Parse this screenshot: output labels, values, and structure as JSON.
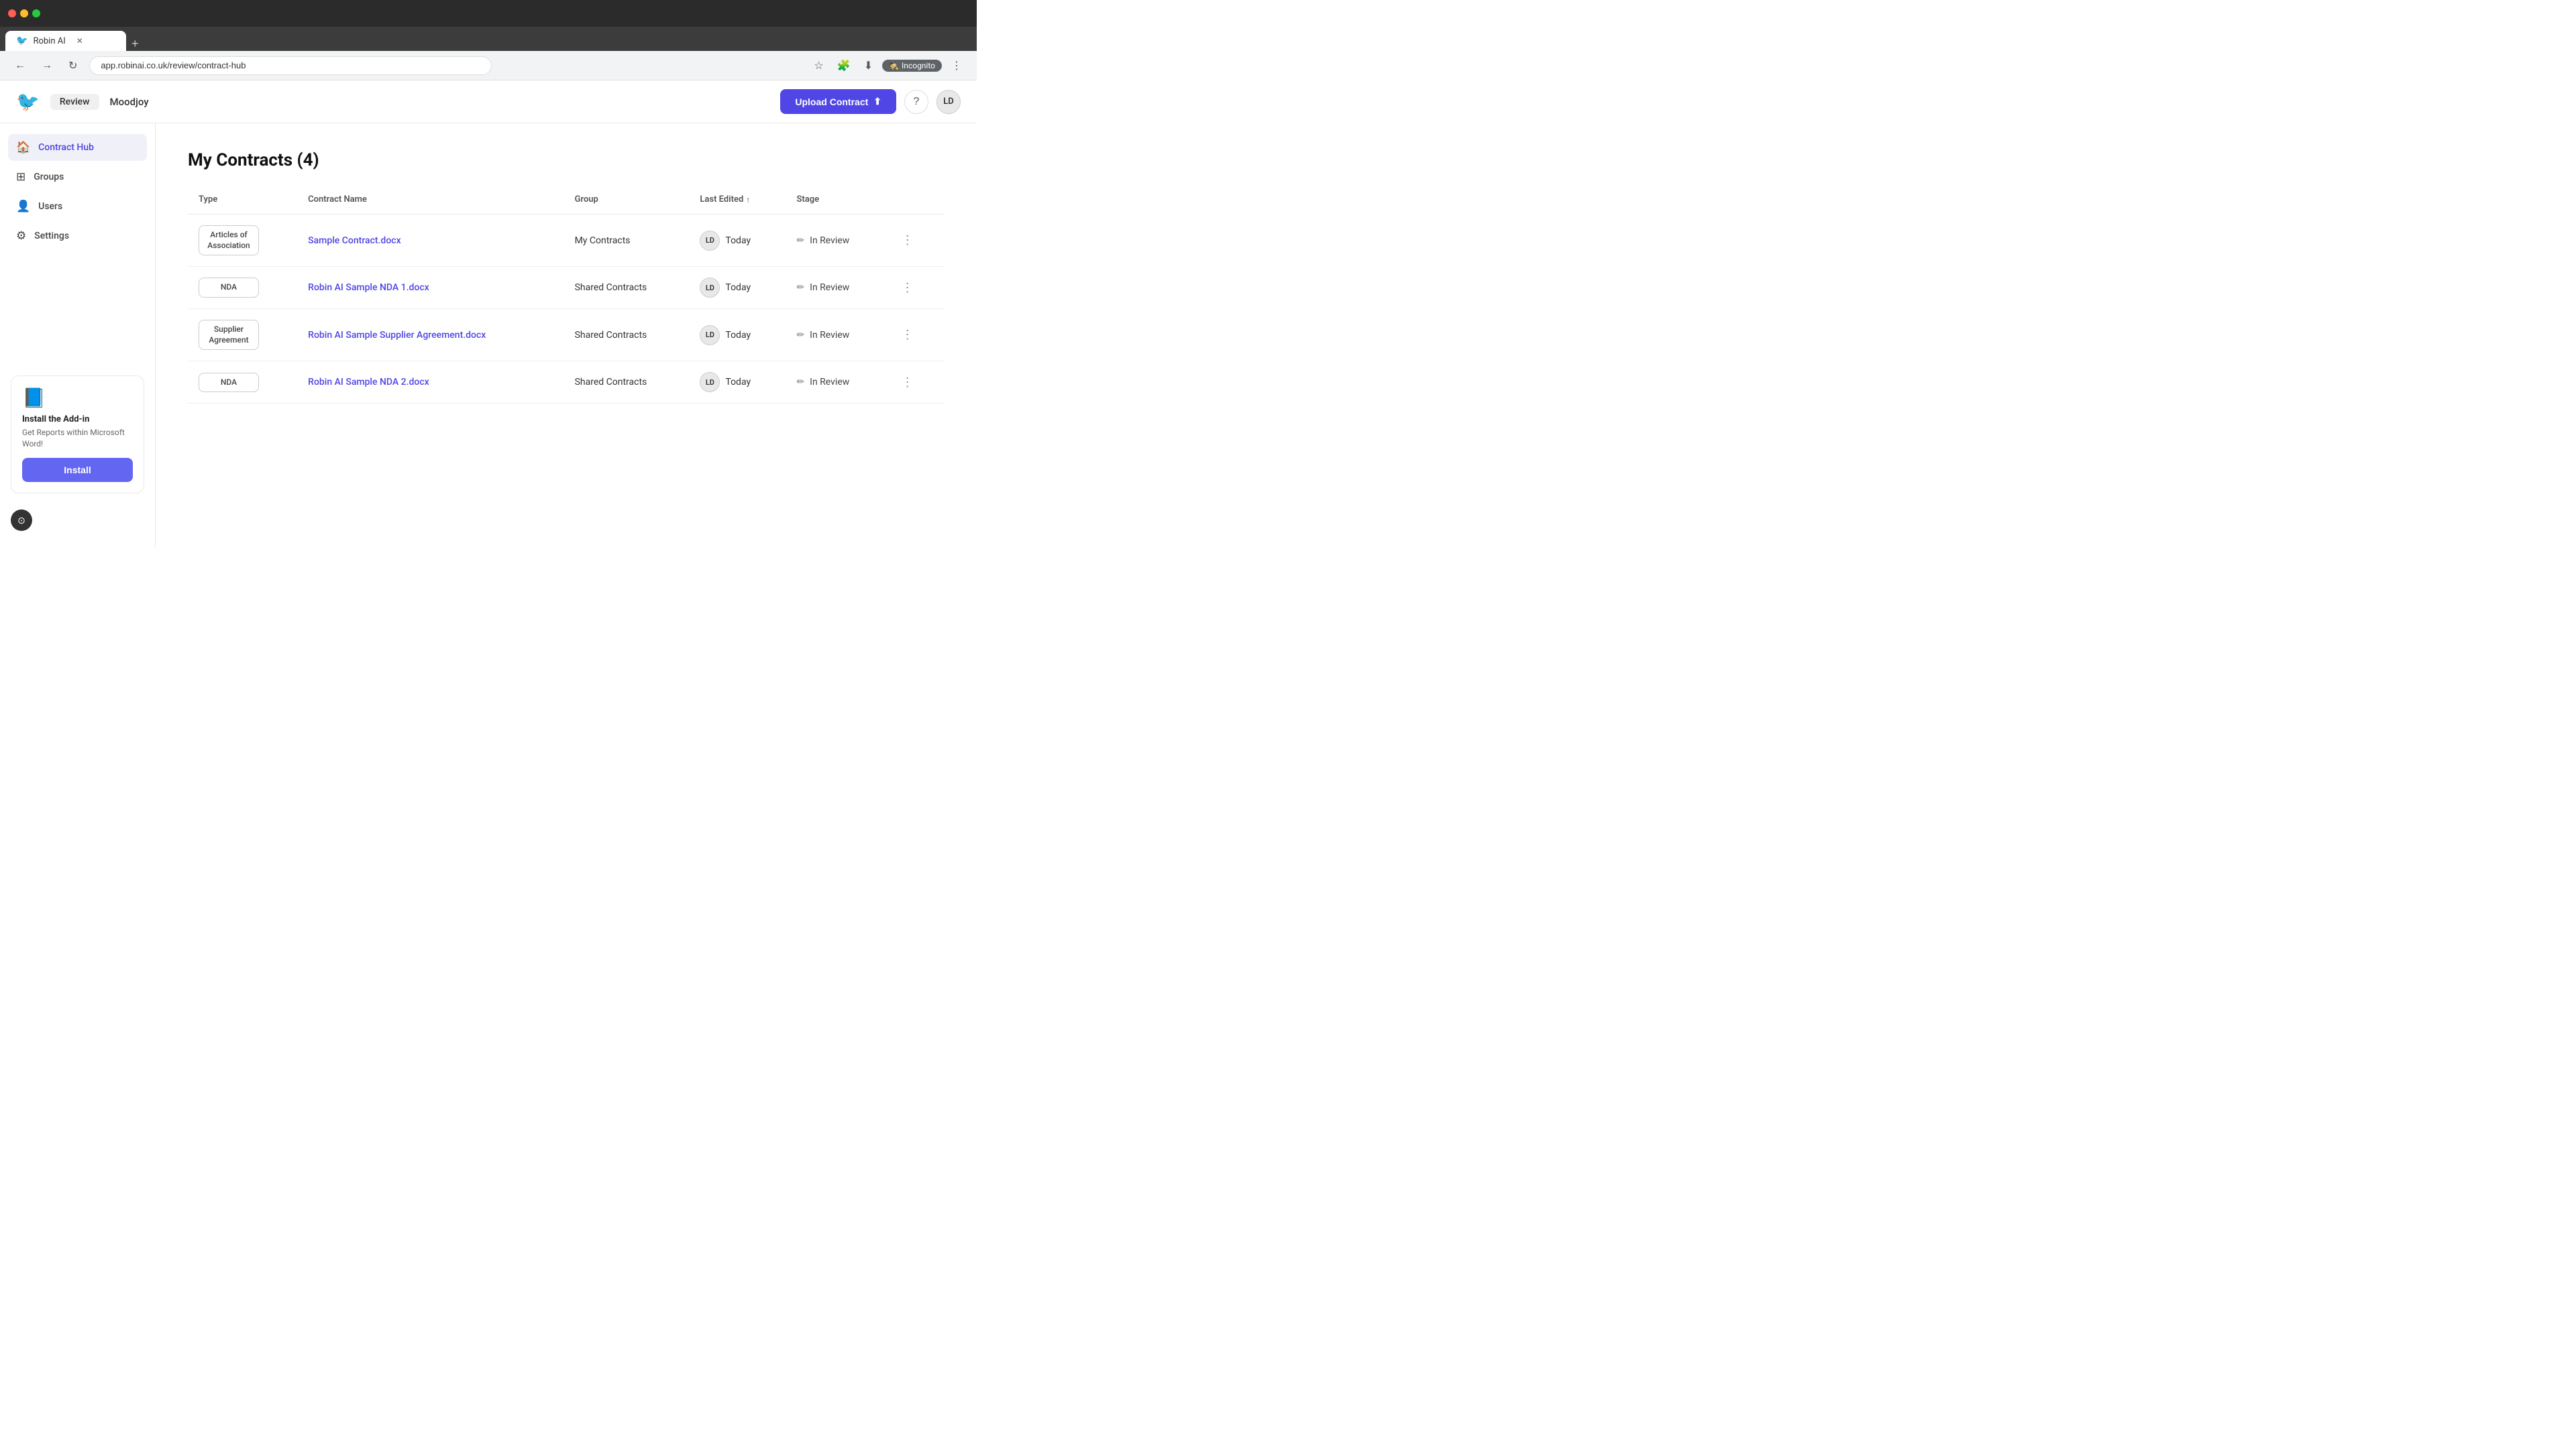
{
  "browser": {
    "tab_title": "Robin AI",
    "url": "app.robinai.co.uk/review/contract-hub",
    "incognito_label": "Incognito"
  },
  "header": {
    "review_label": "Review",
    "workspace_name": "Moodjoy",
    "upload_button": "Upload Contract",
    "help_icon": "?",
    "avatar_initials": "LD"
  },
  "sidebar": {
    "items": [
      {
        "label": "Contract Hub",
        "icon": "🏠",
        "active": true
      },
      {
        "label": "Groups",
        "icon": "⊞"
      },
      {
        "label": "Users",
        "icon": "👤"
      },
      {
        "label": "Settings",
        "icon": "⚙"
      }
    ],
    "addin": {
      "title": "Install the Add-in",
      "description": "Get Reports within Microsoft Word!",
      "button_label": "Install"
    }
  },
  "main": {
    "page_title": "My Contracts (4)",
    "table": {
      "columns": [
        "Type",
        "Contract Name",
        "Group",
        "Last Edited",
        "Stage"
      ],
      "rows": [
        {
          "type": "Articles of\nAssociation",
          "contract_name": "Sample Contract.docx",
          "group": "My Contracts",
          "avatar": "LD",
          "last_edited": "Today",
          "stage": "In Review"
        },
        {
          "type": "NDA",
          "contract_name": "Robin AI Sample NDA 1.docx",
          "group": "Shared Contracts",
          "avatar": "LD",
          "last_edited": "Today",
          "stage": "In Review"
        },
        {
          "type": "Supplier\nAgreement",
          "contract_name": "Robin AI Sample Supplier Agreement.docx",
          "group": "Shared Contracts",
          "avatar": "LD",
          "last_edited": "Today",
          "stage": "In Review"
        },
        {
          "type": "NDA",
          "contract_name": "Robin AI Sample NDA 2.docx",
          "group": "Shared Contracts",
          "avatar": "LD",
          "last_edited": "Today",
          "stage": "In Review"
        }
      ]
    }
  },
  "colors": {
    "accent": "#4f46e5",
    "upload_bg": "#4f46e5",
    "install_bg": "#6366f1"
  }
}
